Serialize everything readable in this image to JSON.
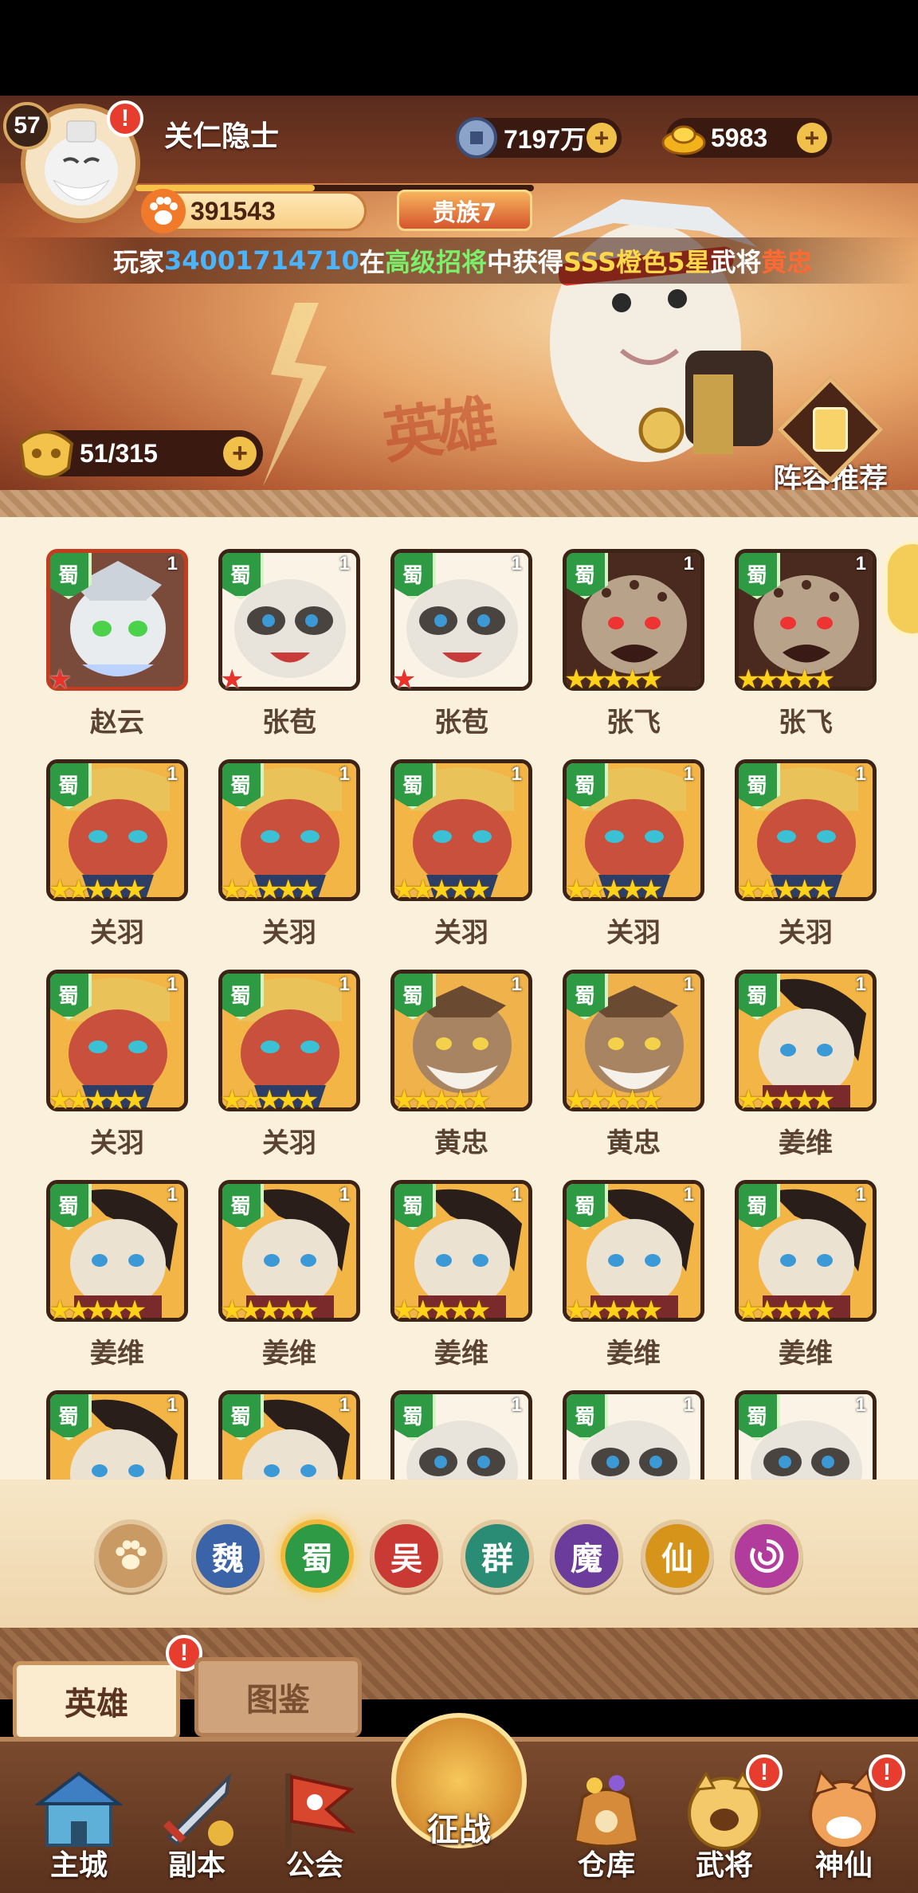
{
  "player": {
    "level": "57",
    "name": "关仁隐士",
    "power": "391543",
    "noble": "贵族7",
    "alert": "!"
  },
  "resources": {
    "copper": {
      "icon": "copper-coin-icon",
      "value": "7197万"
    },
    "gold": {
      "icon": "gold-ingot-icon",
      "value": "5983"
    },
    "plus": "+"
  },
  "broadcast": {
    "prefix": "玩家",
    "player_id": "34001714710",
    "word_in": "在",
    "event": "高级招将",
    "word_gain": "中获得",
    "rarity": "SSS橙色5星",
    "word_general": "武将",
    "hero": "黄忠"
  },
  "banner": {
    "decor_text": "英雄",
    "hero_count": "51/315",
    "lineup_label": "阵容推荐"
  },
  "hero_grid": [
    {
      "name": "赵云",
      "faction": "蜀",
      "level": "1",
      "stars": 1,
      "star_color": "red",
      "art": "white-knight"
    },
    {
      "name": "张苞",
      "faction": "蜀",
      "level": "1",
      "stars": 1,
      "star_color": "red",
      "art": "panda"
    },
    {
      "name": "张苞",
      "faction": "蜀",
      "level": "1",
      "stars": 1,
      "star_color": "red",
      "art": "panda"
    },
    {
      "name": "张飞",
      "faction": "蜀",
      "level": "1",
      "stars": 5,
      "star_color": "gold",
      "art": "leopard"
    },
    {
      "name": "张飞",
      "faction": "蜀",
      "level": "1",
      "stars": 5,
      "star_color": "gold",
      "art": "leopard"
    },
    {
      "name": "关羽",
      "faction": "蜀",
      "level": "1",
      "stars": 5,
      "star_color": "gold",
      "art": "red-face"
    },
    {
      "name": "关羽",
      "faction": "蜀",
      "level": "1",
      "stars": 5,
      "star_color": "gold",
      "art": "red-face"
    },
    {
      "name": "关羽",
      "faction": "蜀",
      "level": "1",
      "stars": 5,
      "star_color": "gold",
      "art": "red-face"
    },
    {
      "name": "关羽",
      "faction": "蜀",
      "level": "1",
      "stars": 5,
      "star_color": "gold",
      "art": "red-face"
    },
    {
      "name": "关羽",
      "faction": "蜀",
      "level": "1",
      "stars": 5,
      "star_color": "gold",
      "art": "red-face"
    },
    {
      "name": "关羽",
      "faction": "蜀",
      "level": "1",
      "stars": 5,
      "star_color": "gold",
      "art": "red-face"
    },
    {
      "name": "关羽",
      "faction": "蜀",
      "level": "1",
      "stars": 5,
      "star_color": "gold",
      "art": "red-face"
    },
    {
      "name": "黄忠",
      "faction": "蜀",
      "level": "1",
      "stars": 5,
      "star_color": "gold",
      "art": "old-tiger"
    },
    {
      "name": "黄忠",
      "faction": "蜀",
      "level": "1",
      "stars": 5,
      "star_color": "gold",
      "art": "old-tiger"
    },
    {
      "name": "姜维",
      "faction": "蜀",
      "level": "1",
      "stars": 5,
      "star_color": "gold",
      "art": "tabby"
    },
    {
      "name": "姜维",
      "faction": "蜀",
      "level": "1",
      "stars": 5,
      "star_color": "gold",
      "art": "tabby"
    },
    {
      "name": "姜维",
      "faction": "蜀",
      "level": "1",
      "stars": 5,
      "star_color": "gold",
      "art": "tabby"
    },
    {
      "name": "姜维",
      "faction": "蜀",
      "level": "1",
      "stars": 5,
      "star_color": "gold",
      "art": "tabby"
    },
    {
      "name": "姜维",
      "faction": "蜀",
      "level": "1",
      "stars": 5,
      "star_color": "gold",
      "art": "tabby"
    },
    {
      "name": "姜维",
      "faction": "蜀",
      "level": "1",
      "stars": 5,
      "star_color": "gold",
      "art": "tabby"
    },
    {
      "name": "",
      "faction": "蜀",
      "level": "1",
      "stars": 0,
      "star_color": "gold",
      "art": "tabby"
    },
    {
      "name": "",
      "faction": "蜀",
      "level": "1",
      "stars": 0,
      "star_color": "gold",
      "art": "tabby"
    },
    {
      "name": "",
      "faction": "蜀",
      "level": "1",
      "stars": 0,
      "star_color": "gold",
      "art": "panda"
    },
    {
      "name": "",
      "faction": "蜀",
      "level": "1",
      "stars": 0,
      "star_color": "gold",
      "art": "panda"
    },
    {
      "name": "",
      "faction": "蜀",
      "level": "1",
      "stars": 0,
      "star_color": "gold",
      "art": "panda"
    }
  ],
  "faction_filters": [
    {
      "key": "all",
      "label": "",
      "icon": "paw-icon",
      "color": "#c99a63",
      "active": false
    },
    {
      "key": "wei",
      "label": "魏",
      "color": "#3b63a8",
      "active": false
    },
    {
      "key": "shu",
      "label": "蜀",
      "color": "#2f9a45",
      "active": true
    },
    {
      "key": "wu",
      "label": "吴",
      "color": "#c83a33",
      "active": false
    },
    {
      "key": "qun",
      "label": "群",
      "color": "#2a8c75",
      "active": false
    },
    {
      "key": "mo",
      "label": "魔",
      "color": "#6b3c9c",
      "active": false
    },
    {
      "key": "xian",
      "label": "仙",
      "color": "#d6951a",
      "active": false
    },
    {
      "key": "special",
      "label": "",
      "icon": "spiral-icon",
      "color": "#b23c9c",
      "active": false
    }
  ],
  "tabs": {
    "heroes": "英雄",
    "codex": "图鉴"
  },
  "nav": {
    "city": "主城",
    "dungeon": "副本",
    "guild": "公会",
    "battle": "征战",
    "storage": "仓库",
    "generals": "武将",
    "immortals": "神仙"
  },
  "colors": {
    "accent": "#f1c04a",
    "shu_green": "#2e9a44",
    "bg_cream": "#fbf0dc"
  }
}
